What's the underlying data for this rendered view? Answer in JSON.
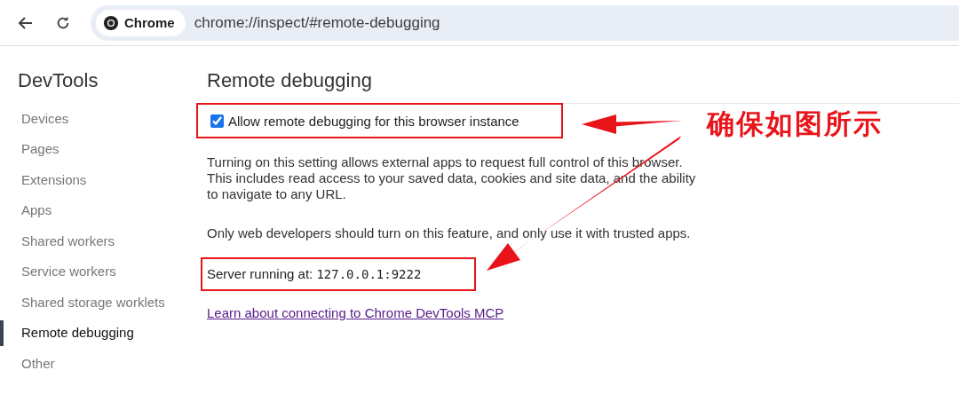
{
  "toolbar": {
    "chip_label": "Chrome",
    "url": "chrome://inspect/#remote-debugging"
  },
  "sidebar": {
    "title": "DevTools",
    "items": [
      {
        "label": "Devices",
        "selected": false
      },
      {
        "label": "Pages",
        "selected": false
      },
      {
        "label": "Extensions",
        "selected": false
      },
      {
        "label": "Apps",
        "selected": false
      },
      {
        "label": "Shared workers",
        "selected": false
      },
      {
        "label": "Service workers",
        "selected": false
      },
      {
        "label": "Shared storage worklets",
        "selected": false
      },
      {
        "label": "Remote debugging",
        "selected": true
      },
      {
        "label": "Other",
        "selected": false
      }
    ]
  },
  "main": {
    "title": "Remote debugging",
    "checkbox": {
      "label": "Allow remote debugging for this browser instance",
      "checked": true
    },
    "paragraphs": [
      "Turning on this setting allows external apps to request full control of this browser. This includes read access to your saved data, cookies and site data, and the ability to navigate to any URL.",
      "Only web developers should turn on this feature, and only use it with trusted apps."
    ],
    "server": {
      "label": "Server running at:",
      "value": "127.0.0.1:9222"
    },
    "link": "Learn about connecting to Chrome DevTools MCP"
  },
  "annotation": {
    "text": "确保如图所示"
  }
}
